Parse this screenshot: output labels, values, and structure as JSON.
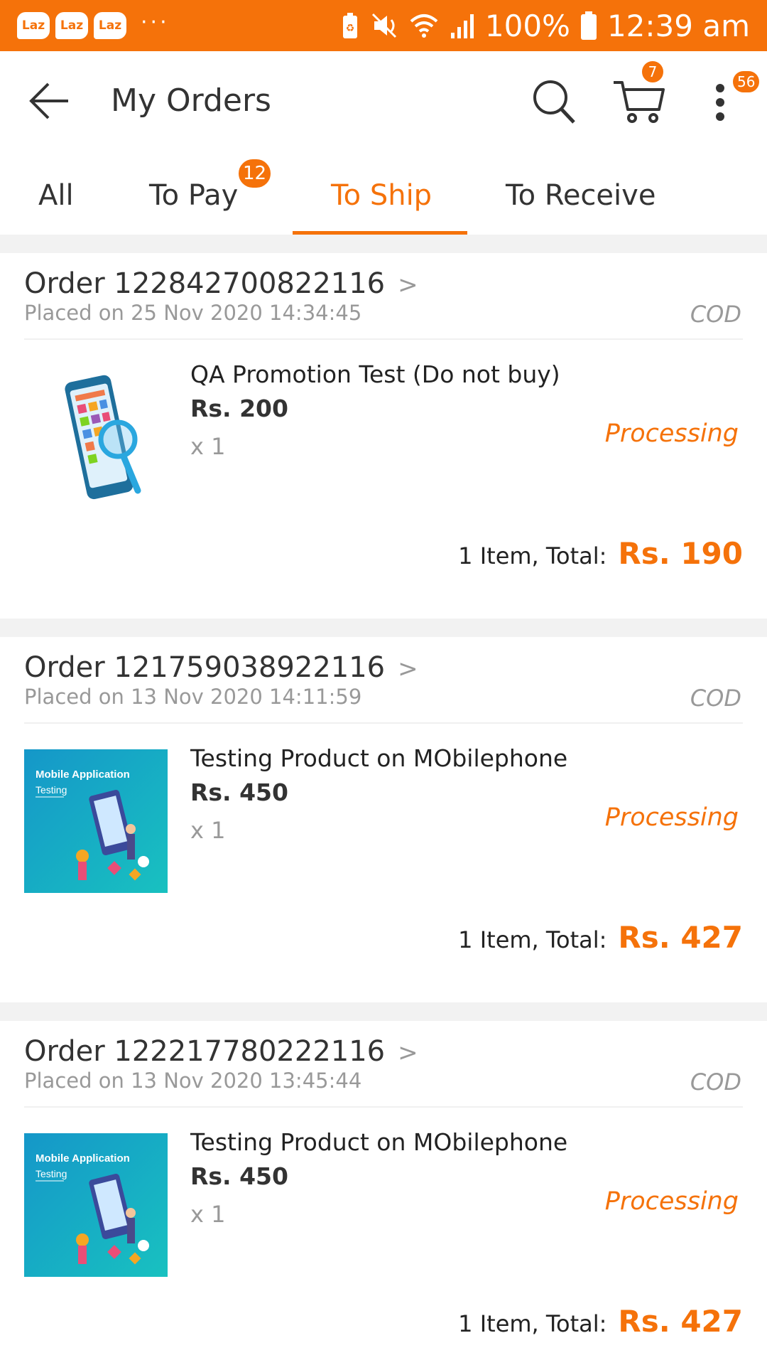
{
  "status_bar": {
    "app_icons": [
      "Laz",
      "Laz",
      "Laz"
    ],
    "more": "···",
    "battery_percent": "100%",
    "time": "12:39 am"
  },
  "header": {
    "title": "My Orders",
    "cart_badge": "7",
    "more_badge": "56"
  },
  "tabs": [
    {
      "label": "All"
    },
    {
      "label": "To Pay",
      "badge": "12"
    },
    {
      "label": "To Ship",
      "active": true
    },
    {
      "label": "To Receive"
    }
  ],
  "orders": [
    {
      "order_no": "Order 122842700822116",
      "chevron": ">",
      "placed": "Placed on 25 Nov 2020 14:34:45",
      "payment": "COD",
      "product_name": "QA Promotion Test (Do not buy)",
      "price": "Rs. 200",
      "qty": "x 1",
      "status": "Processing",
      "total_label": "1 Item, Total:",
      "total_value": "Rs. 190"
    },
    {
      "order_no": "Order 121759038922116",
      "chevron": ">",
      "placed": "Placed on 13 Nov 2020 14:11:59",
      "payment": "COD",
      "product_name": "Testing Product on MObilephone",
      "price": "Rs. 450",
      "qty": "x 1",
      "status": "Processing",
      "total_label": "1 Item, Total:",
      "total_value": "Rs. 427",
      "thumb_title": "Mobile Application",
      "thumb_sub": "Testing"
    },
    {
      "order_no": "Order 122217780222116",
      "chevron": ">",
      "placed": "Placed on 13 Nov 2020 13:45:44",
      "payment": "COD",
      "product_name": "Testing Product on MObilephone",
      "price": "Rs. 450",
      "qty": "x 1",
      "status": "Processing",
      "total_label": "1 Item, Total:",
      "total_value": "Rs. 427",
      "thumb_title": "Mobile Application",
      "thumb_sub": "Testing"
    }
  ],
  "colors": {
    "accent": "#f5720a",
    "muted": "#999999",
    "divider": "#f2f2f2"
  }
}
